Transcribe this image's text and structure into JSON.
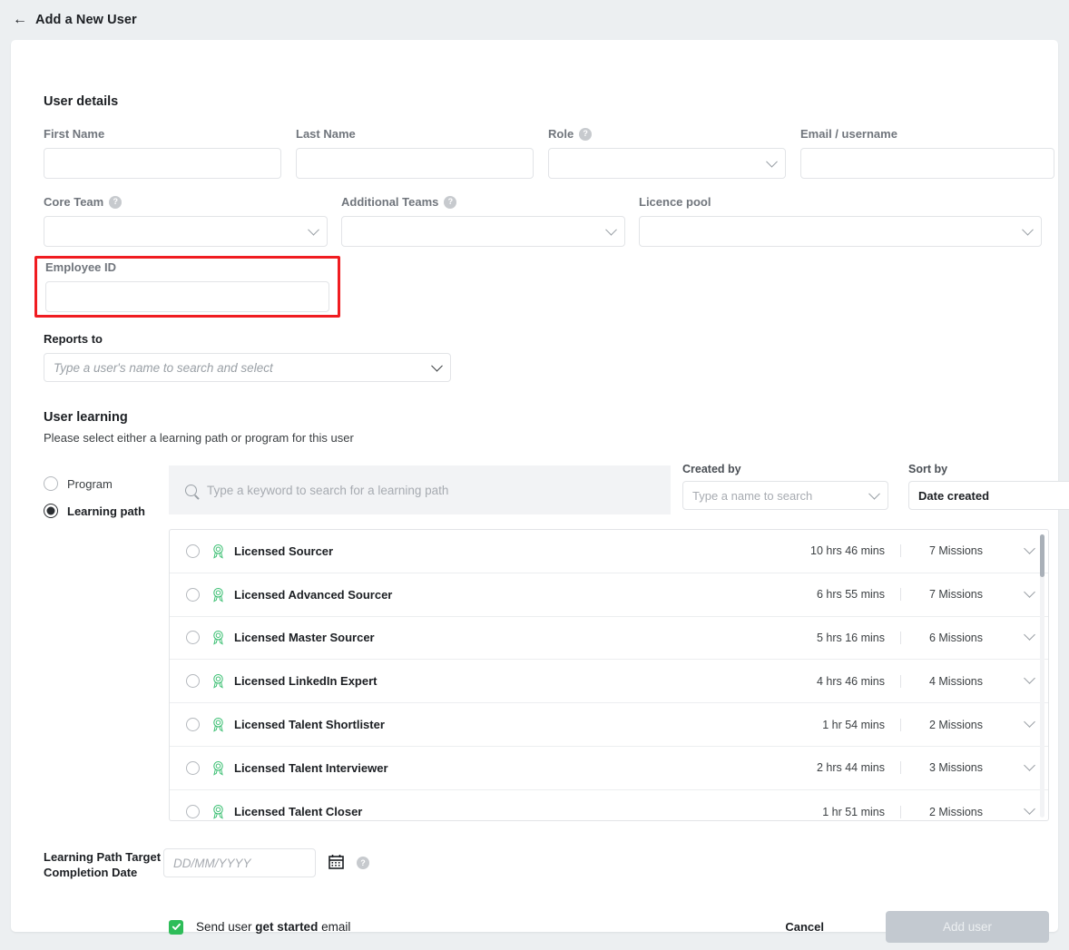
{
  "header": {
    "back_icon": "arrow-left-icon",
    "title": "Add a New User"
  },
  "user_details": {
    "section_title": "User details",
    "first_name": {
      "label": "First Name",
      "value": "",
      "placeholder": ""
    },
    "last_name": {
      "label": "Last Name",
      "value": "",
      "placeholder": ""
    },
    "role": {
      "label": "Role",
      "value": "",
      "help": "?"
    },
    "email": {
      "label": "Email / username",
      "value": "",
      "placeholder": ""
    },
    "core_team": {
      "label": "Core Team",
      "value": "",
      "help": "?"
    },
    "additional_teams": {
      "label": "Additional Teams",
      "value": "",
      "help": "?"
    },
    "licence_pool": {
      "label": "Licence pool",
      "value": ""
    },
    "employee_id": {
      "label": "Employee ID",
      "value": "",
      "highlight_color": "#f01c21"
    },
    "reports_to": {
      "label": "Reports to",
      "placeholder": "Type a user's name to search and select"
    }
  },
  "user_learning": {
    "section_title": "User learning",
    "subtitle": "Please select either a learning path or program for this user",
    "options": [
      {
        "label": "Program",
        "selected": false
      },
      {
        "label": "Learning path",
        "selected": true
      }
    ],
    "search": {
      "icon": "search-icon",
      "placeholder": "Type a keyword to search for a learning path",
      "value": ""
    },
    "created_by": {
      "label": "Created by",
      "placeholder": "Type a name to search",
      "value": ""
    },
    "sort_by": {
      "label": "Sort by",
      "value": "Date created"
    },
    "list": [
      {
        "name": "Licensed Sourcer",
        "duration": "10 hrs 46 mins",
        "missions": "7 Missions",
        "icon": "medal-icon",
        "selected": false
      },
      {
        "name": "Licensed Advanced Sourcer",
        "duration": "6 hrs 55 mins",
        "missions": "7 Missions",
        "icon": "medal-icon",
        "selected": false
      },
      {
        "name": "Licensed Master Sourcer",
        "duration": "5 hrs 16 mins",
        "missions": "6 Missions",
        "icon": "medal-icon",
        "selected": false
      },
      {
        "name": "Licensed LinkedIn Expert",
        "duration": "4 hrs 46 mins",
        "missions": "4 Missions",
        "icon": "medal-icon",
        "selected": false
      },
      {
        "name": "Licensed Talent Shortlister",
        "duration": "1 hr 54 mins",
        "missions": "2 Missions",
        "icon": "medal-icon",
        "selected": false
      },
      {
        "name": "Licensed Talent Interviewer",
        "duration": "2 hrs 44 mins",
        "missions": "3 Missions",
        "icon": "medal-icon",
        "selected": false
      },
      {
        "name": "Licensed Talent Closer",
        "duration": "1 hr 51 mins",
        "missions": "2 Missions",
        "icon": "medal-icon",
        "selected": false
      }
    ]
  },
  "target_date": {
    "label": "Learning Path Target Completion Date",
    "placeholder": "DD/MM/YYYY",
    "value": "",
    "calendar_icon": "calendar-icon",
    "help": "?"
  },
  "footer": {
    "checkbox_checked": true,
    "checkbox_text_before": "Send user ",
    "checkbox_text_bold": "get started",
    "checkbox_text_after": " email",
    "cancel_label": "Cancel",
    "add_label": "Add user",
    "add_disabled": true,
    "accent_green": "#2ebd59"
  }
}
